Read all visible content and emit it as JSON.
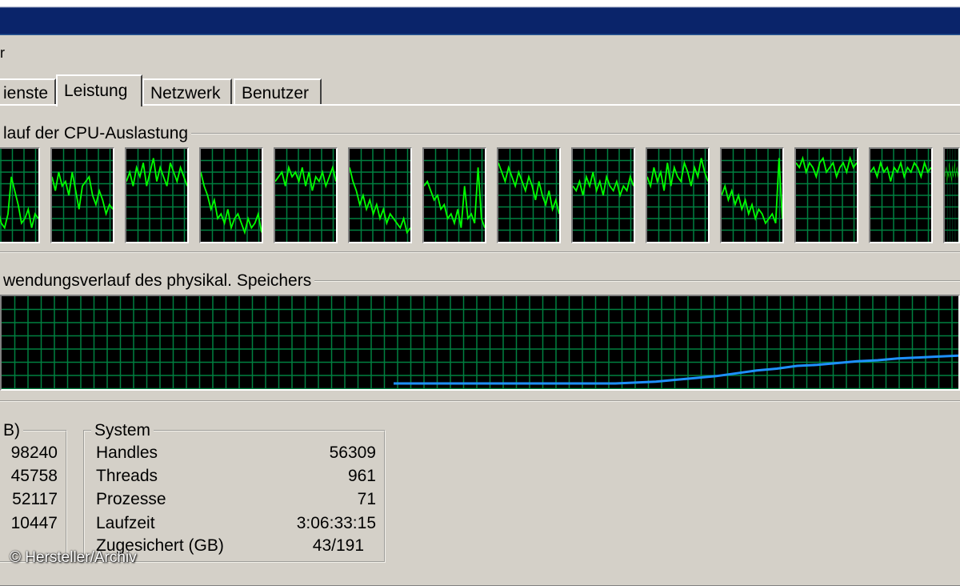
{
  "menu_stub": "r",
  "tabs": [
    {
      "label": "ienste",
      "active": false
    },
    {
      "label": "Leistung",
      "active": true
    },
    {
      "label": "Netzwerk",
      "active": false
    },
    {
      "label": "Benutzer",
      "active": false
    }
  ],
  "cpu_group": {
    "label": "lauf der CPU-Auslastung",
    "cores": [
      {
        "samples": [
          55,
          40,
          25,
          45,
          30,
          60,
          35,
          20,
          15,
          30,
          70,
          55,
          40,
          20,
          25,
          35,
          15,
          30,
          25
        ]
      },
      {
        "samples": [
          70,
          55,
          75,
          60,
          65,
          50,
          75,
          55,
          35,
          60,
          65,
          70,
          50,
          40,
          55,
          45,
          30,
          40,
          35
        ]
      },
      {
        "samples": [
          65,
          75,
          60,
          80,
          70,
          85,
          60,
          75,
          90,
          65,
          80,
          70,
          60,
          85,
          75,
          65,
          80,
          70,
          60
        ]
      },
      {
        "samples": [
          75,
          60,
          50,
          35,
          45,
          25,
          30,
          20,
          35,
          15,
          25,
          30,
          20,
          10,
          25,
          15,
          20,
          30,
          10
        ]
      },
      {
        "samples": [
          65,
          70,
          75,
          60,
          80,
          70,
          75,
          65,
          80,
          60,
          75,
          55,
          70,
          65,
          75,
          60,
          70,
          80,
          65
        ]
      },
      {
        "samples": [
          80,
          65,
          55,
          40,
          50,
          35,
          45,
          30,
          40,
          25,
          35,
          20,
          30,
          25,
          20,
          15,
          25,
          10,
          15
        ]
      },
      {
        "samples": [
          60,
          65,
          55,
          45,
          50,
          35,
          40,
          25,
          30,
          20,
          35,
          15,
          60,
          25,
          30,
          20,
          80,
          25,
          15
        ]
      },
      {
        "samples": [
          85,
          75,
          65,
          80,
          70,
          60,
          75,
          65,
          55,
          70,
          60,
          45,
          65,
          50,
          40,
          55,
          35,
          45,
          30
        ]
      },
      {
        "samples": [
          60,
          55,
          65,
          50,
          70,
          60,
          75,
          55,
          65,
          50,
          70,
          60,
          55,
          65,
          50,
          60,
          55,
          70,
          60
        ]
      },
      {
        "samples": [
          70,
          60,
          80,
          65,
          75,
          55,
          85,
          60,
          80,
          70,
          65,
          85,
          75,
          60,
          80,
          70,
          90,
          75,
          65
        ]
      },
      {
        "samples": [
          50,
          60,
          45,
          55,
          40,
          50,
          35,
          45,
          30,
          40,
          25,
          35,
          30,
          20,
          25,
          30,
          20,
          90,
          25
        ]
      },
      {
        "samples": [
          85,
          80,
          90,
          75,
          85,
          80,
          70,
          85,
          90,
          75,
          80,
          85,
          70,
          80,
          85,
          75,
          90,
          80,
          85
        ]
      },
      {
        "samples": [
          75,
          80,
          70,
          85,
          75,
          80,
          65,
          80,
          75,
          85,
          70,
          80,
          75,
          85,
          80,
          70,
          85,
          75,
          80
        ]
      },
      {
        "samples": [
          70,
          75,
          80,
          65,
          75,
          70,
          85,
          70,
          75,
          65,
          80,
          70,
          75,
          85,
          70,
          75,
          80,
          70,
          75
        ]
      }
    ]
  },
  "memory_group": {
    "label": "wendungsverlauf des physikal. Speichers",
    "samples": [
      6,
      6,
      6,
      6,
      6,
      6,
      6,
      6,
      6,
      6,
      6,
      6,
      7,
      8,
      10,
      12,
      14,
      17,
      20,
      22,
      25,
      26,
      28,
      30,
      31,
      33,
      34,
      35,
      36
    ]
  },
  "left_panel": {
    "label": "B)",
    "values": [
      "98240",
      "45758",
      "52117",
      "10447"
    ]
  },
  "system_panel": {
    "label": "System",
    "rows": [
      {
        "label": "Handles",
        "value": "56309"
      },
      {
        "label": "Threads",
        "value": "961"
      },
      {
        "label": "Prozesse",
        "value": "71"
      },
      {
        "label": "Laufzeit",
        "value": "3:06:33:15"
      },
      {
        "label": "Zugesichert (GB)",
        "value": "43/191"
      }
    ]
  },
  "watermark": "© Hersteller/Archiv",
  "colors": {
    "window_bg": "#d4d0c8",
    "title_bar": "#0a246a",
    "graph_bg": "#000000",
    "grid": "#008040",
    "cpu_line": "#00ff00",
    "mem_line": "#1e90ff"
  }
}
